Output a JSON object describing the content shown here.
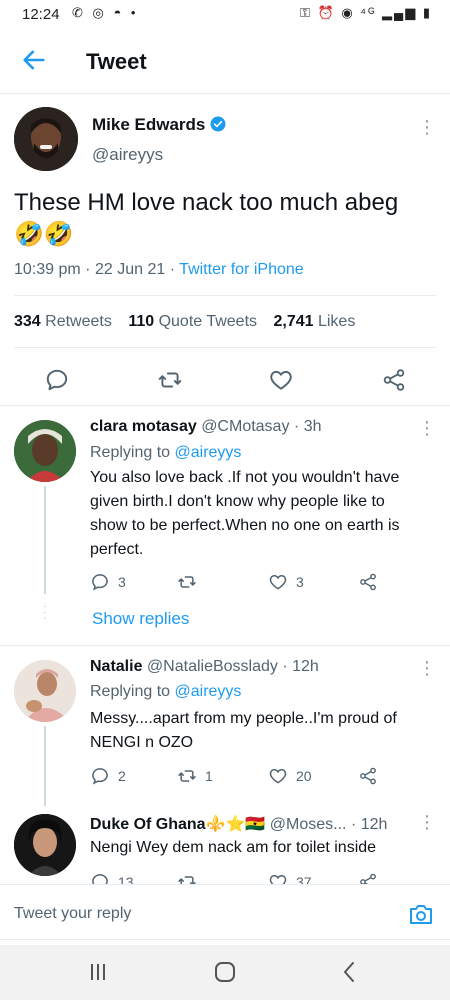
{
  "status_bar": {
    "time": "12:24",
    "left_icons": [
      "missed-call-icon",
      "whatsapp-icon",
      "chat-icon",
      "dot-icon"
    ],
    "right_icons": [
      "key-icon",
      "alarm-icon",
      "hotspot-icon",
      "4g-signal-icon",
      "battery-icon"
    ],
    "left_glyphs": "✆ ◎ ◓ •",
    "right_glyphs": "⚿ ⏰ ◉ ⁴ᴳ ▂▄▆ ▮"
  },
  "header": {
    "title": "Tweet"
  },
  "main_tweet": {
    "author_name": "Mike Edwards",
    "handle": "@aireyys",
    "text": "These HM love nack too much abeg 🤣🤣",
    "time": "10:39 pm",
    "date": "22 Jun 21",
    "source": "Twitter for iPhone",
    "retweets": "334",
    "retweets_label": "Retweets",
    "quotes": "110",
    "quotes_label": "Quote Tweets",
    "likes": "2,741",
    "likes_label": "Likes"
  },
  "replies": [
    {
      "name": "clara motasay",
      "handle": "@CMotasay",
      "time": "3h",
      "replying_label": "Replying to",
      "replying_to": "@aireyys",
      "text": "You also love back .If not you wouldn't have given birth.I don't know why people like to show to be perfect.When no one on earth is perfect.",
      "reply_count": "3",
      "retweet_count": "",
      "like_count": "3",
      "show_replies": "Show replies"
    },
    {
      "name": "Natalie",
      "handle": "@NatalieBosslady",
      "time": "12h",
      "replying_label": "Replying to",
      "replying_to": "@aireyys",
      "text": "Messy....apart from my people..I'm proud of NENGI n OZO",
      "reply_count": "2",
      "retweet_count": "1",
      "like_count": "20"
    },
    {
      "name": "Duke Of Ghana",
      "name_emoji": "⚜️⭐🇬🇭",
      "handle": "@Moses...",
      "time": "12h",
      "text": "Nengi Wey dem nack am for toilet inside",
      "reply_count": "13",
      "retweet_count": "",
      "like_count": "37"
    }
  ],
  "compose": {
    "placeholder": "Tweet your reply"
  },
  "colors": {
    "accent": "#1d9bf0",
    "secondary_text": "#536471",
    "divider": "#e6ecf0"
  }
}
